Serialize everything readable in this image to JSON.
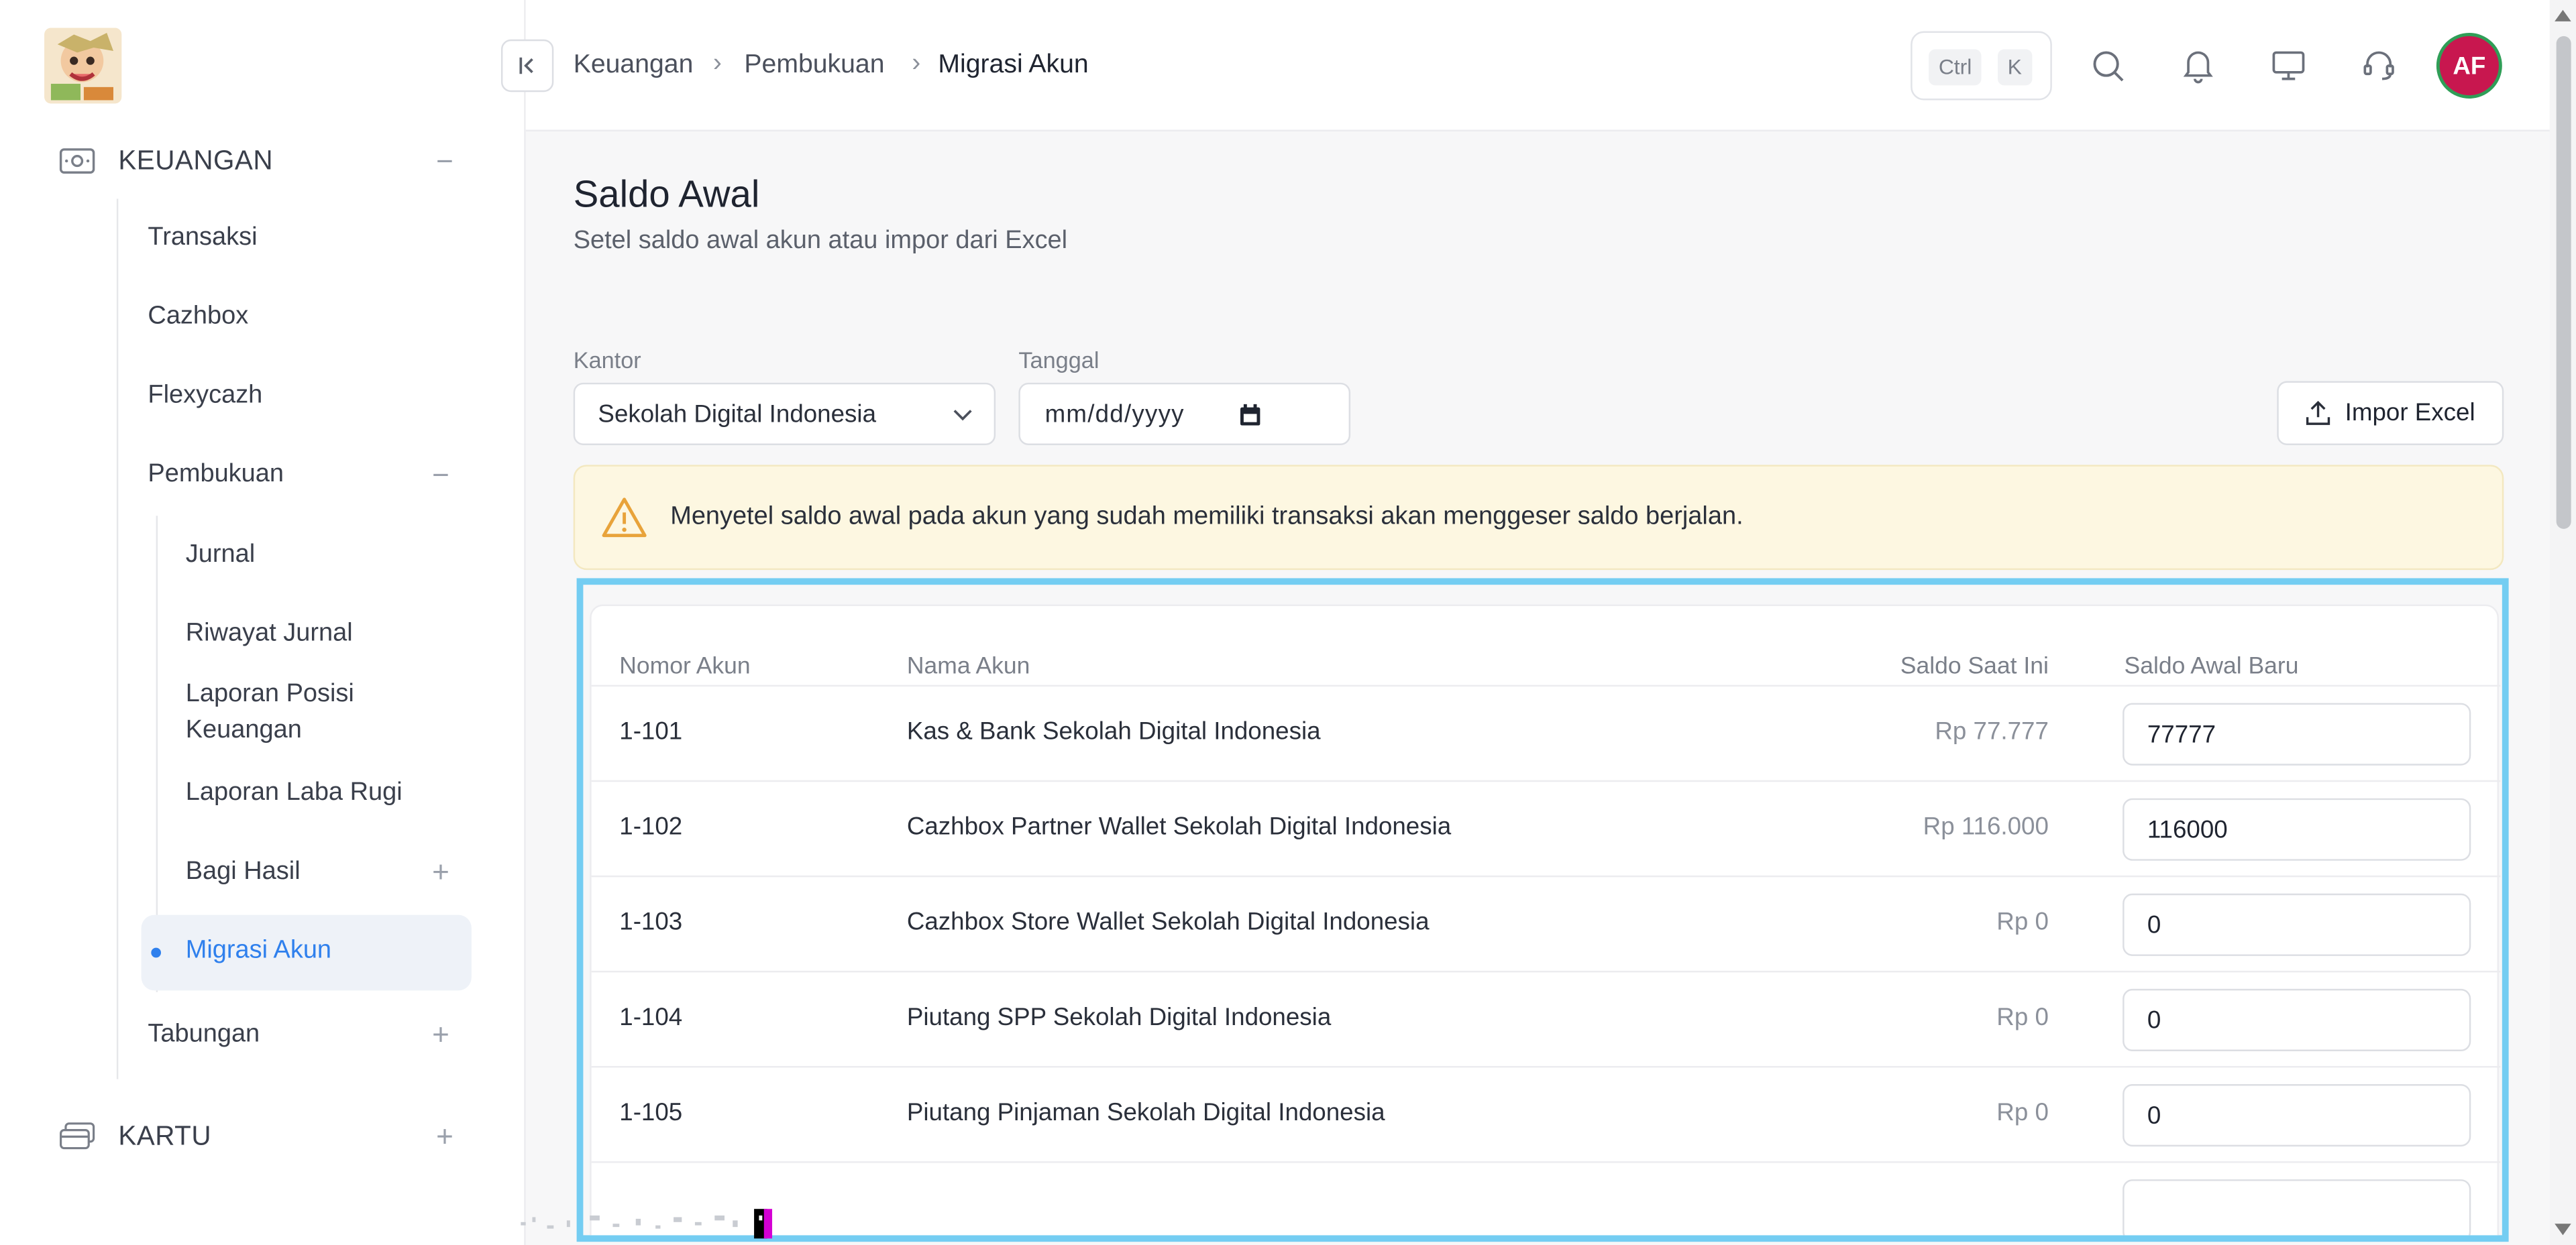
{
  "sidebar": {
    "groups": {
      "keuangan": "KEUANGAN",
      "kartu": "KARTU"
    },
    "items": {
      "transaksi": "Transaksi",
      "cazhbox": "Cazhbox",
      "flexycazh": "Flexycazh",
      "pembukuan": "Pembukuan",
      "jurnal": "Jurnal",
      "riwayat_jurnal": "Riwayat Jurnal",
      "laporan_posisi_1": "Laporan Posisi",
      "laporan_posisi_2": "Keuangan",
      "laporan_laba_rugi": "Laporan Laba Rugi",
      "bagi_hasil": "Bagi Hasil",
      "migrasi_akun": "Migrasi Akun",
      "tabungan": "Tabungan"
    },
    "icons": {
      "expanded": "−",
      "collapsed": "+"
    }
  },
  "header": {
    "breadcrumb": [
      "Keuangan",
      "Pembukuan",
      "Migrasi Akun"
    ],
    "kbd": [
      "Ctrl",
      "K"
    ],
    "avatar": "AF"
  },
  "page": {
    "title": "Saldo Awal",
    "subtitle": "Setel saldo awal akun atau impor dari Excel"
  },
  "filters": {
    "kantor_label": "Kantor",
    "kantor_value": "Sekolah Digital Indonesia",
    "tanggal_label": "Tanggal",
    "tanggal_placeholder": "mm/dd/yyyy",
    "import_label": "Impor Excel"
  },
  "alert": {
    "text": "Menyetel saldo awal pada akun yang sudah memiliki transaksi akan menggeser saldo berjalan."
  },
  "table": {
    "headers": {
      "nomor": "Nomor Akun",
      "nama": "Nama Akun",
      "saldo": "Saldo Saat Ini",
      "baru": "Saldo Awal Baru"
    },
    "rows": [
      {
        "nomor": "1-101",
        "nama": "Kas & Bank Sekolah Digital Indonesia",
        "saldo": "Rp 77.777",
        "baru": "77777"
      },
      {
        "nomor": "1-102",
        "nama": "Cazhbox Partner Wallet Sekolah Digital Indonesia",
        "saldo": "Rp 116.000",
        "baru": "116000"
      },
      {
        "nomor": "1-103",
        "nama": "Cazhbox Store Wallet Sekolah Digital Indonesia",
        "saldo": "Rp 0",
        "baru": "0"
      },
      {
        "nomor": "1-104",
        "nama": "Piutang SPP Sekolah Digital Indonesia",
        "saldo": "Rp 0",
        "baru": "0"
      },
      {
        "nomor": "1-105",
        "nama": "Piutang Pinjaman Sekolah Digital Indonesia",
        "saldo": "Rp 0",
        "baru": "0"
      }
    ]
  },
  "colors": {
    "accent": "#2f80ed",
    "highlight_frame": "#74cdf2",
    "alert_bg": "#fdf7e1",
    "warning_icon": "#e8a33a",
    "avatar_bg": "#c8174f"
  }
}
